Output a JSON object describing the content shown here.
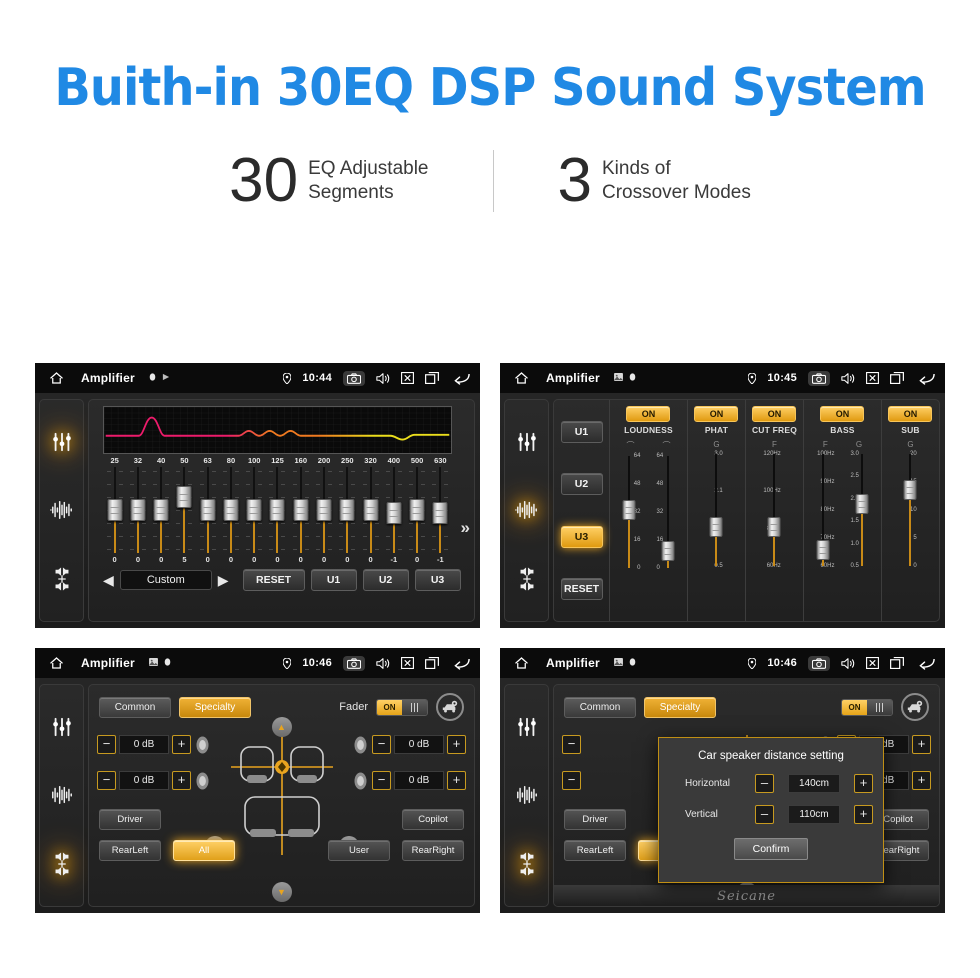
{
  "hero": {
    "title": "Buith-in 30EQ DSP Sound System",
    "stats": [
      {
        "number": "30",
        "line1": "EQ Adjustable",
        "line2": "Segments"
      },
      {
        "number": "3",
        "line1": "Kinds of",
        "line2": "Crossover Modes"
      }
    ]
  },
  "colors": {
    "title_blue": "#2089e4",
    "accent_amber": "#e8a41f",
    "screen_bg": "#1b1b1b",
    "curve_low": "#ee1b6b",
    "curve_mid": "#f07a20",
    "curve_high": "#ecdf1c"
  },
  "screen1": {
    "statusbar": {
      "title": "Amplifier",
      "time": "10:44"
    },
    "sidebar": [
      "equalizer-icon",
      "waveform-icon",
      "balance-icon"
    ],
    "eq": {
      "frequencies": [
        "25",
        "32",
        "40",
        "50",
        "63",
        "80",
        "100",
        "125",
        "160",
        "200",
        "250",
        "320",
        "400",
        "500",
        "630"
      ],
      "values": [
        "0",
        "0",
        "0",
        "5",
        "0",
        "0",
        "0",
        "0",
        "0",
        "0",
        "0",
        "0",
        "-1",
        "0",
        "-1"
      ],
      "gains": [
        0,
        0,
        0,
        5,
        0,
        0,
        0,
        0,
        0,
        0,
        0,
        0,
        -1,
        0,
        -1
      ]
    },
    "controls": {
      "prev": "◀",
      "preset_name": "Custom",
      "next": "▶",
      "reset": "RESET",
      "u1": "U1",
      "u2": "U2",
      "u3": "U3",
      "more": "»"
    }
  },
  "screen2": {
    "statusbar": {
      "title": "Amplifier",
      "time": "10:45"
    },
    "presets": [
      {
        "label": "U1",
        "active": false
      },
      {
        "label": "U2",
        "active": false
      },
      {
        "label": "U3",
        "active": true
      },
      {
        "label": "RESET",
        "active": false
      }
    ],
    "modules": [
      {
        "label": "LOUDNESS",
        "state": "ON",
        "sub": [
          "⌒",
          "⌒"
        ],
        "scale_left": [
          "64",
          "48",
          "32",
          "16",
          "0"
        ],
        "scale_right": [
          "64",
          "48",
          "32",
          "16",
          "0"
        ],
        "knob_left_pct": 52,
        "knob_right_pct": 8
      },
      {
        "label": "PHAT",
        "state": "ON",
        "sub": [
          "G"
        ],
        "scale_left": [
          "3.0",
          "2.1",
          "1.3",
          "0.5"
        ],
        "knob_left_pct": 32
      },
      {
        "label": "CUT FREQ",
        "state": "ON",
        "sub": [
          "F"
        ],
        "scale_left": [
          "120Hz",
          "100Hz",
          "80Hz",
          "60Hz"
        ],
        "knob_left_pct": 32
      },
      {
        "label": "BASS",
        "state": "ON",
        "sub": [
          "F",
          "G"
        ],
        "scale_left": [
          "100Hz",
          "90Hz",
          "80Hz",
          "70Hz",
          "60Hz"
        ],
        "scale_right": [
          "3.0",
          "2.5",
          "2.0",
          "1.5",
          "1.0",
          "0.5"
        ],
        "knob_left_pct": 6,
        "knob_right_pct": 56
      },
      {
        "label": "SUB",
        "state": "ON",
        "sub": [
          "G"
        ],
        "scale_left": [
          "20",
          "15",
          "10",
          "5",
          "0"
        ],
        "knob_left_pct": 72
      }
    ]
  },
  "screen3": {
    "statusbar": {
      "title": "Amplifier",
      "time": "10:46"
    },
    "tabs": [
      {
        "label": "Common",
        "selected": false
      },
      {
        "label": "Specialty",
        "selected": true
      }
    ],
    "fader": {
      "label": "Fader",
      "state": "ON"
    },
    "car_settings_icon": "car-settings-icon",
    "db_controls": [
      {
        "position": "front-left",
        "value": "0 dB"
      },
      {
        "position": "rear-left",
        "value": "0 dB"
      },
      {
        "position": "front-right",
        "value": "0 dB"
      },
      {
        "position": "rear-right",
        "value": "0 dB"
      }
    ],
    "seat_buttons": [
      {
        "label": "Driver",
        "selected": false
      },
      {
        "label": "RearLeft",
        "selected": false
      },
      {
        "label": "All",
        "selected": true
      },
      {
        "label": "User",
        "selected": false
      },
      {
        "label": "Copilot",
        "selected": false
      },
      {
        "label": "RearRight",
        "selected": false
      }
    ]
  },
  "screen4": {
    "statusbar": {
      "title": "Amplifier",
      "time": "10:46"
    },
    "dialog": {
      "title": "Car speaker distance setting",
      "rows": [
        {
          "label": "Horizontal",
          "value": "140cm",
          "minus": "–",
          "plus": "+"
        },
        {
          "label": "Vertical",
          "value": "110cm",
          "minus": "–",
          "plus": "+"
        }
      ],
      "confirm": "Confirm"
    }
  },
  "watermark": "Seicane"
}
